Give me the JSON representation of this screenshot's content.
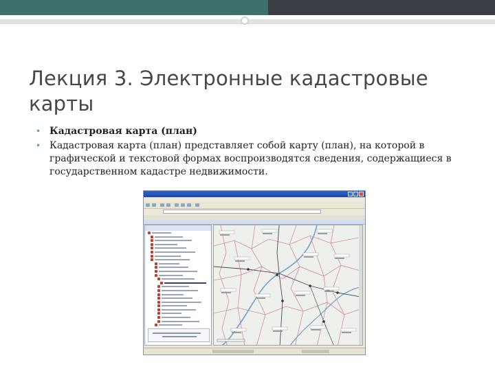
{
  "slide": {
    "title": "Лекция 3. Электронные кадастровые карты",
    "bullets": [
      {
        "text": "Кадастровая карта (план)",
        "bold": true
      },
      {
        "text": "Кадастровая карта (план) представляет собой карту (план), на которой в графической и текстовой формах воспроизводятся сведения, содержащиеся в государственном кадастре недвижимости.",
        "bold": false
      }
    ]
  },
  "theme": {
    "header_teal": "#3e6f6a",
    "header_dark": "#3b3f45",
    "bullet_color": "#6b9592",
    "title_color": "#44484c"
  },
  "icons": {
    "bullet": "•"
  }
}
